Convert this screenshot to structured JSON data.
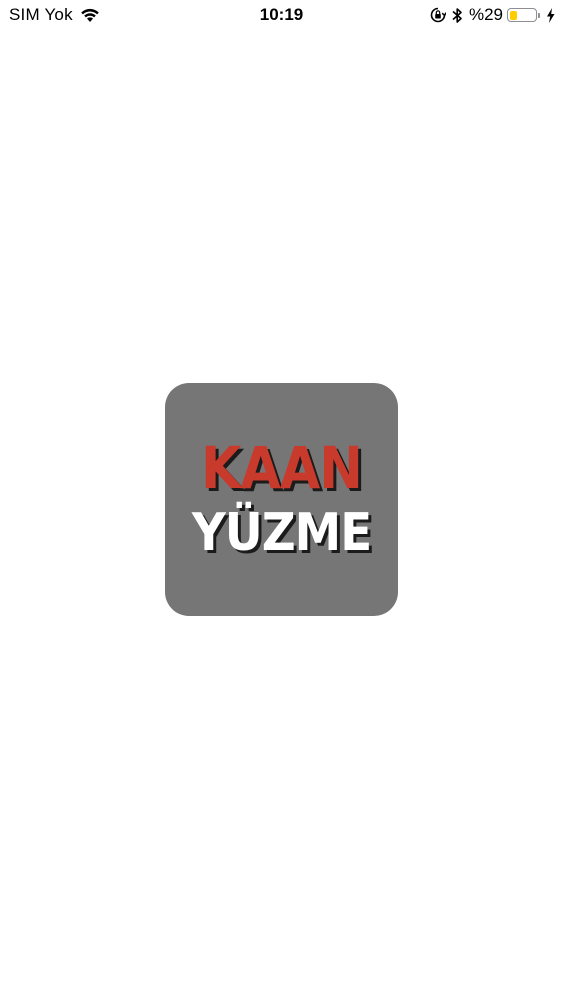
{
  "status_bar": {
    "carrier": "SIM Yok",
    "time": "10:19",
    "battery_percent": "%29",
    "battery_level": 0.29,
    "icons": [
      "wifi-icon",
      "orientation-lock-icon",
      "bluetooth-icon",
      "battery-icon",
      "charging-bolt-icon"
    ]
  },
  "splash": {
    "logo_line_1": "KAAN",
    "logo_line_2": "YÜZME",
    "logo_background": "#767676",
    "logo_red": "#c83a2b",
    "logo_white": "#ffffff"
  }
}
